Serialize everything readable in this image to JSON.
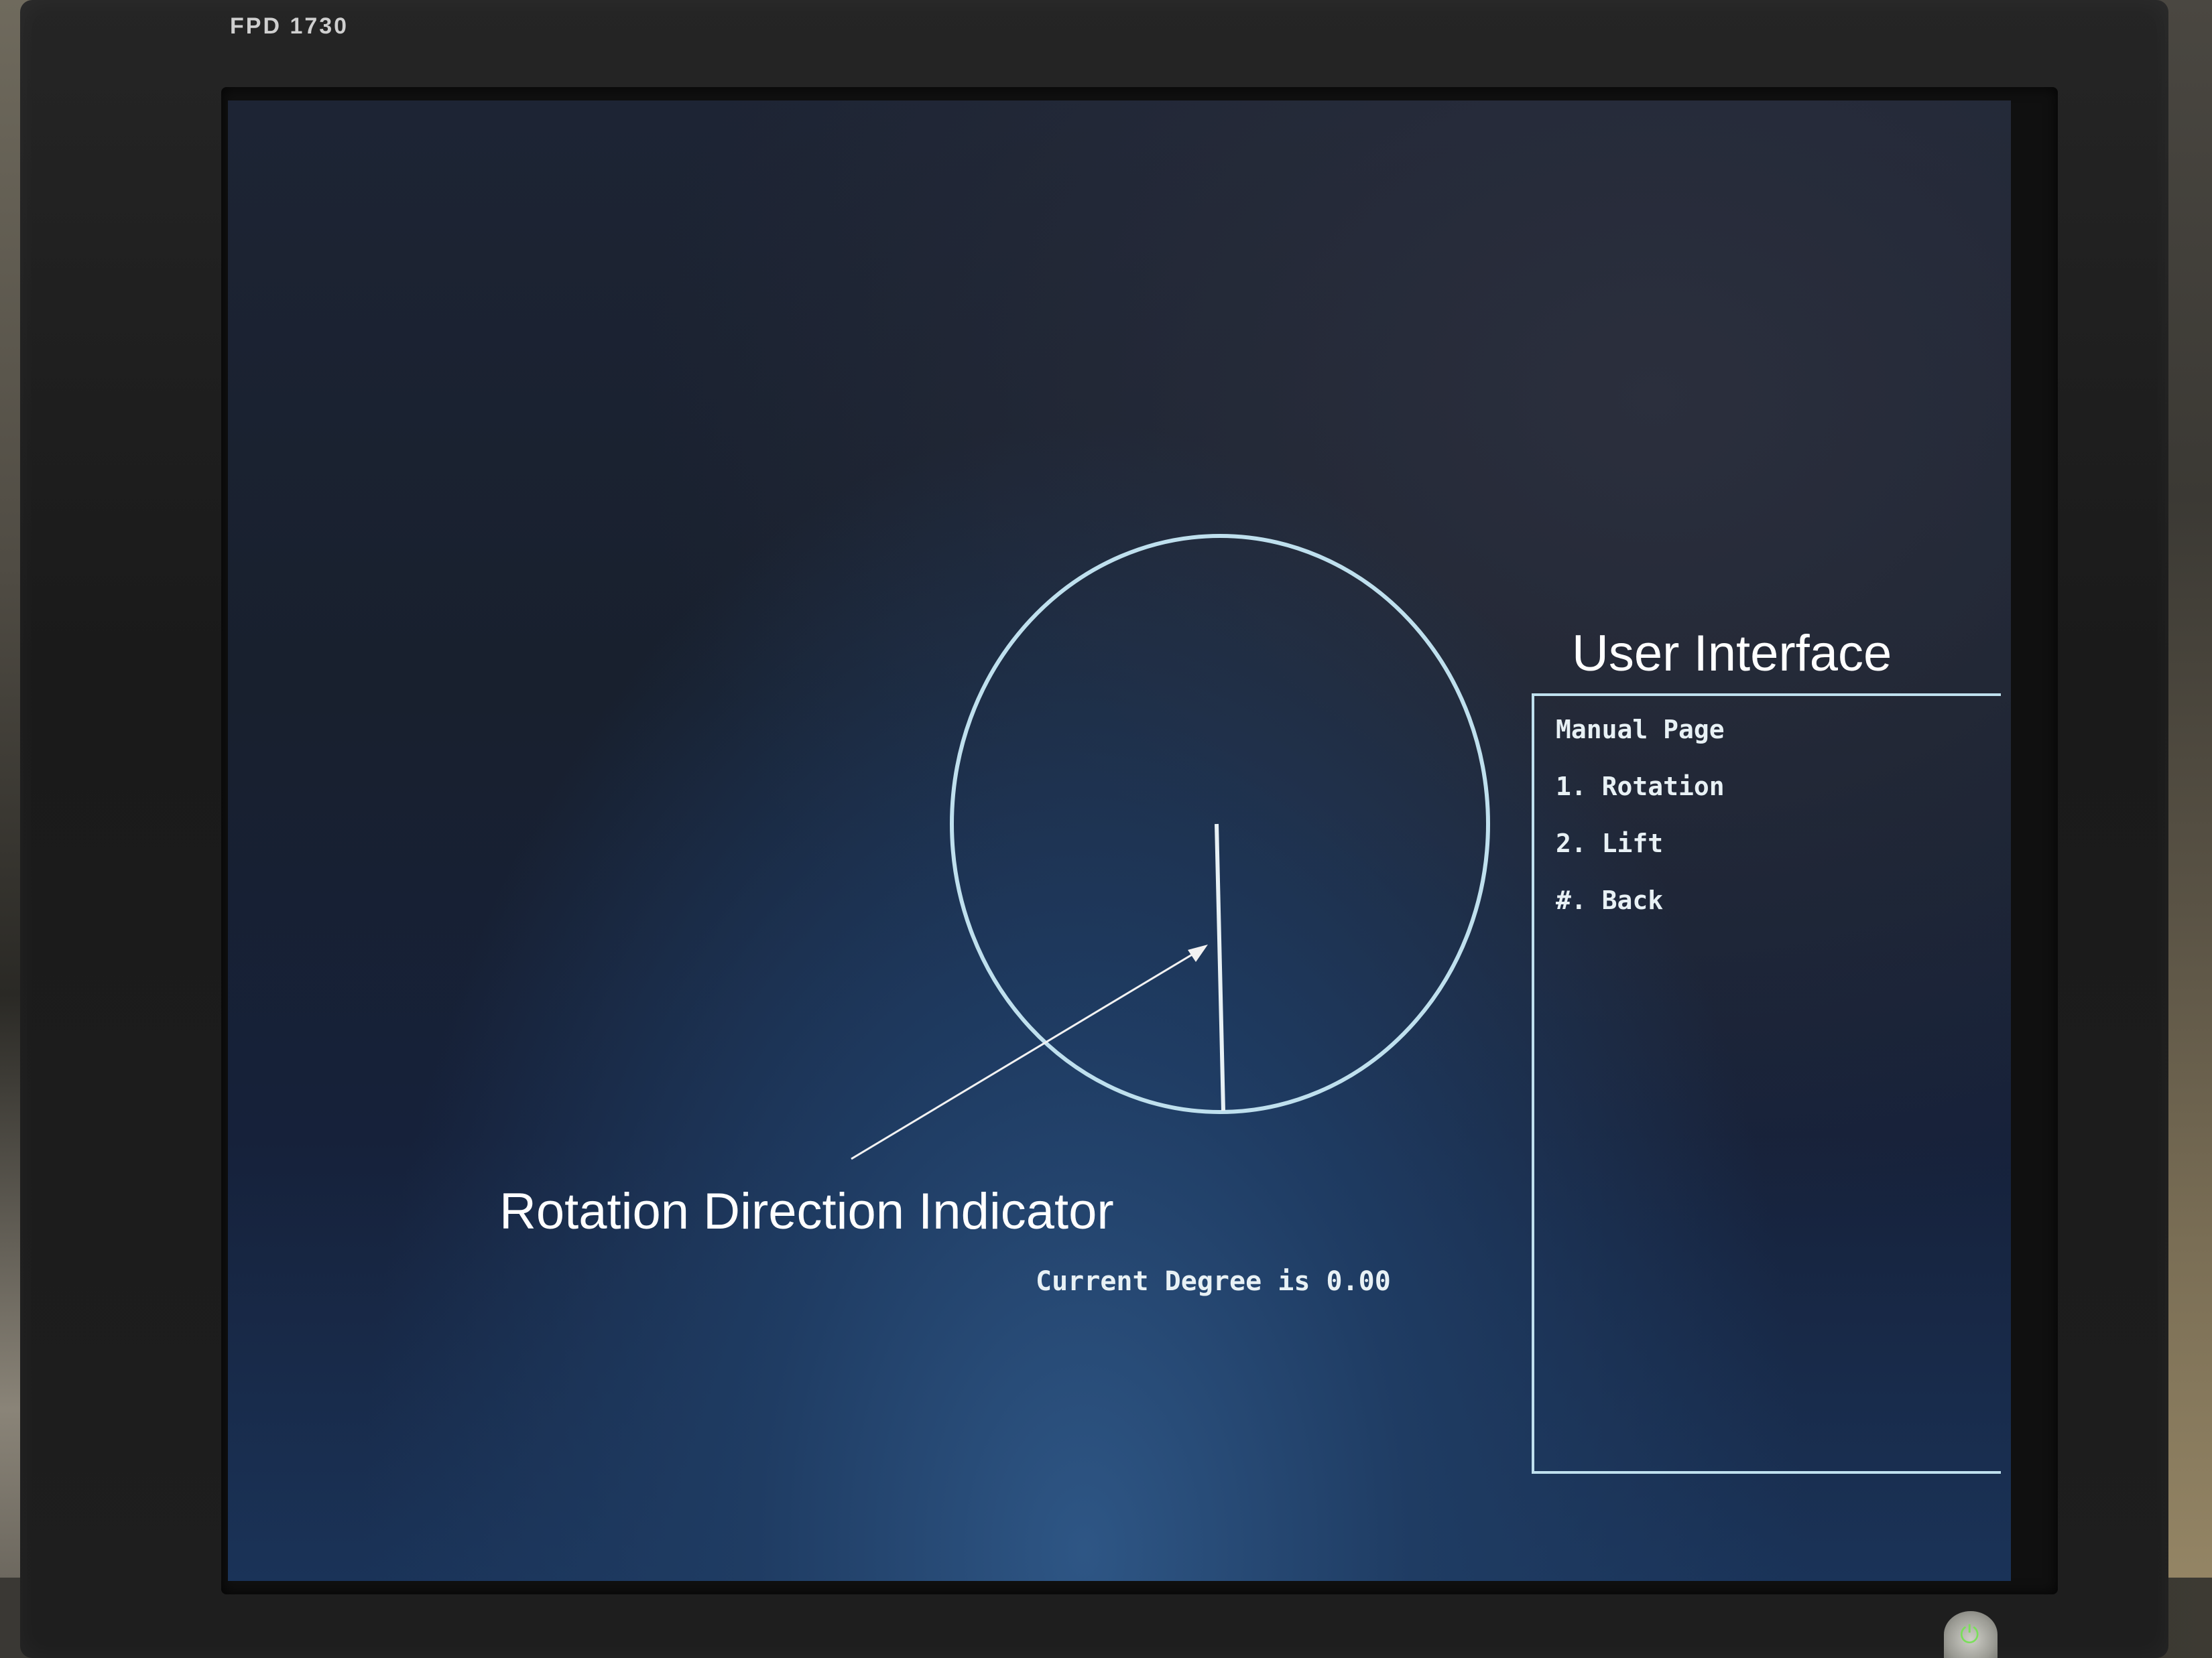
{
  "monitor": {
    "brand_label": "FPD 1730"
  },
  "annotations": {
    "user_interface": "User Interface",
    "rotation_indicator": "Rotation Direction Indicator"
  },
  "dial": {
    "current_degree": 0.0,
    "degree_text": "Current Degree is 0.00",
    "line_color": "#bfe0ee",
    "text_color": "#e8f1f5"
  },
  "panel": {
    "title": "Manual Page",
    "items": [
      {
        "label": "1. Rotation"
      },
      {
        "label": "2. Lift"
      },
      {
        "label": "#. Back"
      }
    ]
  },
  "power": {
    "icon": "power-icon",
    "color": "#7adf5a"
  }
}
